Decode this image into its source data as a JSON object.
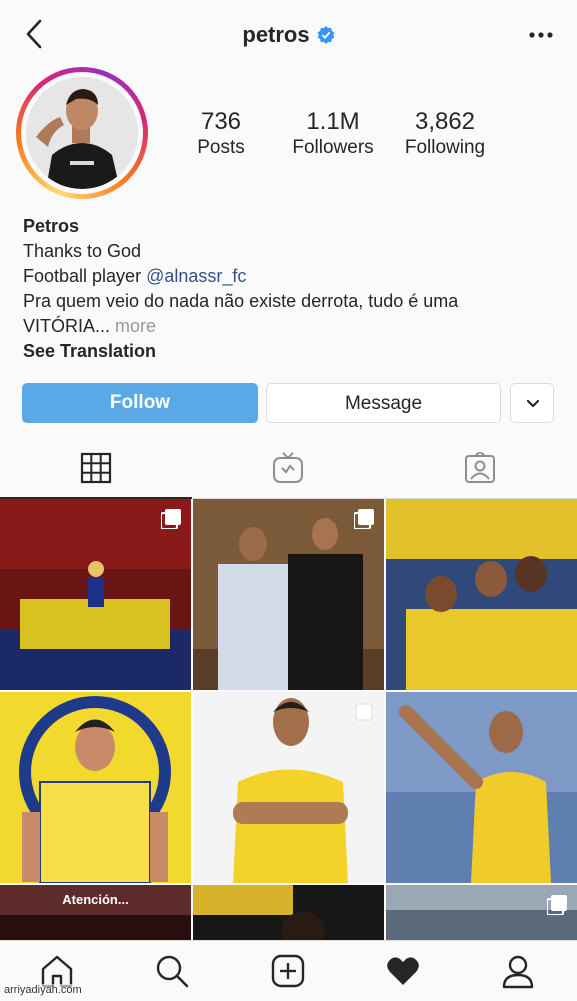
{
  "header": {
    "username": "petros",
    "verified": true
  },
  "profile": {
    "stats": [
      {
        "count": "736",
        "label": "Posts"
      },
      {
        "count": "1.1M",
        "label": "Followers"
      },
      {
        "count": "3,862",
        "label": "Following"
      }
    ],
    "bio": {
      "name": "Petros",
      "line1": "Thanks to God",
      "line2_prefix": "Football player ",
      "line2_mention": "@alnassr_fc",
      "line3": "Pra quem veio do nada não existe derrota, tudo é uma",
      "line4": "VITÓRIA...",
      "more": "more",
      "translation": "See Translation"
    }
  },
  "actions": {
    "follow": "Follow",
    "message": "Message"
  },
  "tabs": [
    "grid",
    "igtv",
    "tagged"
  ],
  "posts": [
    {
      "caption": ""
    },
    {
      "caption": ""
    },
    {
      "caption": ""
    },
    {
      "caption": ""
    },
    {
      "caption": ""
    },
    {
      "caption": ""
    },
    {
      "caption": "Atención..."
    },
    {
      "caption": ""
    },
    {
      "caption": ""
    }
  ],
  "bottom_nav": [
    "home",
    "search",
    "new-post",
    "activity",
    "profile"
  ],
  "watermark": "arriyadiyah.com",
  "colors": {
    "follow_button": "#5aa9e6",
    "mention": "#385185",
    "verified": "#3897f0"
  }
}
